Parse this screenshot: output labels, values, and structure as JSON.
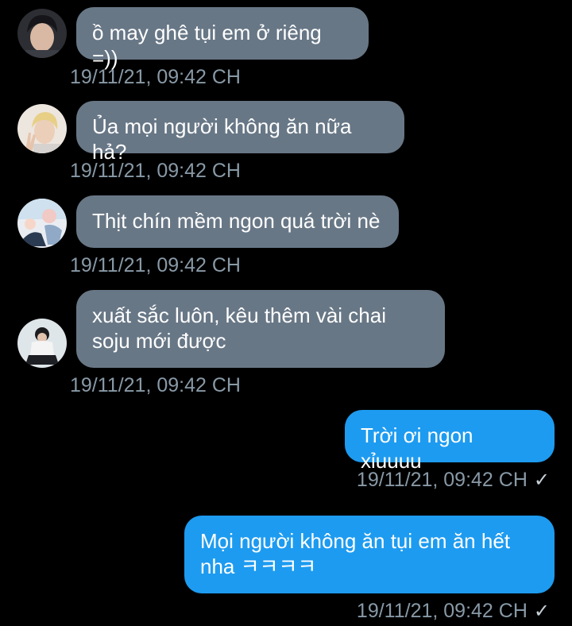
{
  "messages": [
    {
      "direction": "in",
      "avatar": "avatar-dark-hair",
      "text": "ồ may ghê tụi em ở riêng =))",
      "timestamp": "19/11/21, 09:42 CH"
    },
    {
      "direction": "in",
      "avatar": "avatar-blond-peace-sign",
      "text": "Ủa mọi người không ăn nữa hả?",
      "timestamp": "19/11/21, 09:42 CH"
    },
    {
      "direction": "in",
      "avatar": "avatar-pastel-scene",
      "text": "Thịt chín mềm ngon quá trời nè",
      "timestamp": "19/11/21, 09:42 CH"
    },
    {
      "direction": "in",
      "avatar": "avatar-sitting-figure",
      "text": "xuất sắc luôn, kêu thêm vài chai\nsoju mới được",
      "timestamp": "19/11/21, 09:42 CH"
    },
    {
      "direction": "out",
      "text": "Trời ơi ngon xỉuuuu",
      "timestamp": "19/11/21, 09:42 CH",
      "status_icon": "check-icon"
    },
    {
      "direction": "out",
      "text": "Mọi người không ăn tụi em ăn hết\nnha ㅋㅋㅋㅋ",
      "timestamp": "19/11/21, 09:42 CH",
      "status_icon": "check-icon"
    }
  ],
  "colors": {
    "background": "#000000",
    "incoming_bubble": "#687786",
    "outgoing_bubble": "#1d9bf0",
    "timestamp_text": "#8899a6",
    "message_text": "#ffffff"
  }
}
